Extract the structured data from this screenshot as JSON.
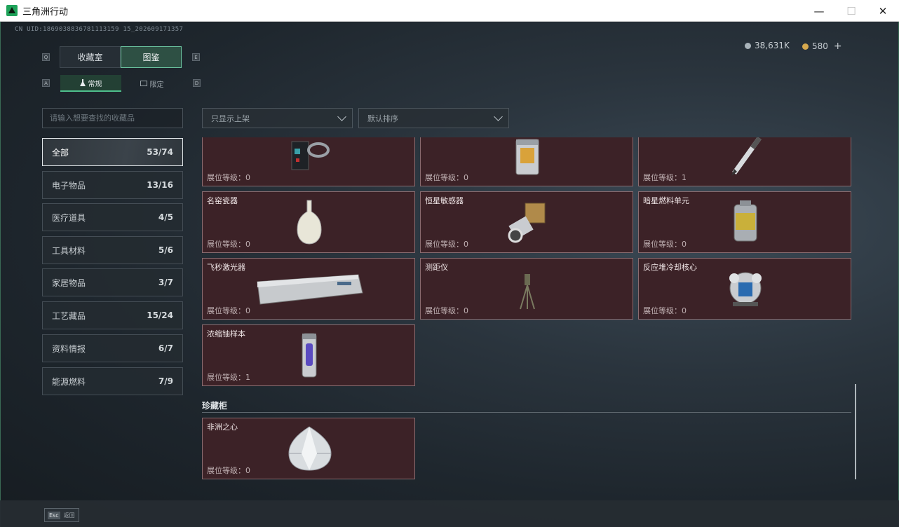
{
  "window": {
    "title": "三角洲行动",
    "minimize": "—",
    "maximize": "☐",
    "close": "✕"
  },
  "uid": "CN UID:1869038836781113159 15_202609171357",
  "currency": {
    "silver": "38,631K",
    "gold": "580",
    "add": "+"
  },
  "keys": {
    "prev_tab": "Q",
    "next_tab": "E",
    "prev_sub": "A",
    "next_sub": "D"
  },
  "tabs": [
    {
      "label": "收藏室"
    },
    {
      "label": "图鉴"
    }
  ],
  "subtabs": [
    {
      "label": "常规"
    },
    {
      "label": "限定"
    }
  ],
  "search": {
    "placeholder": "请输入想要查找的收藏品"
  },
  "filters": {
    "display": "只显示上架",
    "sort": "默认排序"
  },
  "categories": [
    {
      "label": "全部",
      "count": "53/74"
    },
    {
      "label": "电子物品",
      "count": "13/16"
    },
    {
      "label": "医疗道具",
      "count": "4/5"
    },
    {
      "label": "工具材料",
      "count": "5/6"
    },
    {
      "label": "家居物品",
      "count": "3/7"
    },
    {
      "label": "工艺藏品",
      "count": "15/24"
    },
    {
      "label": "资料情报",
      "count": "6/7"
    },
    {
      "label": "能源燃料",
      "count": "7/9"
    }
  ],
  "items": [
    {
      "name": "",
      "level": "展位等级：0",
      "icon": "device-icon"
    },
    {
      "name": "",
      "level": "展位等级：0",
      "icon": "reactor-icon"
    },
    {
      "name": "",
      "level": "展位等级：1",
      "icon": "pen-icon"
    },
    {
      "name": "名窑瓷器",
      "level": "展位等级：0",
      "icon": "vase-icon"
    },
    {
      "name": "恒星敏感器",
      "level": "展位等级：0",
      "icon": "sensor-icon"
    },
    {
      "name": "暗星燃料单元",
      "level": "展位等级：0",
      "icon": "fuel-can-icon"
    },
    {
      "name": "飞秒激光器",
      "level": "展位等级：0",
      "icon": "laser-box-icon"
    },
    {
      "name": "测距仪",
      "level": "展位等级：0",
      "icon": "tripod-icon"
    },
    {
      "name": "反应堆冷却核心",
      "level": "展位等级：0",
      "icon": "cooling-core-icon"
    },
    {
      "name": "浓缩铀样本",
      "level": "展位等级：1",
      "icon": "uranium-icon"
    }
  ],
  "section": {
    "title": "珍藏柜"
  },
  "treasure": [
    {
      "name": "非洲之心",
      "level": "展位等级：0",
      "icon": "diamond-icon"
    }
  ],
  "footer": {
    "esc": "Esc",
    "back": "返回"
  }
}
